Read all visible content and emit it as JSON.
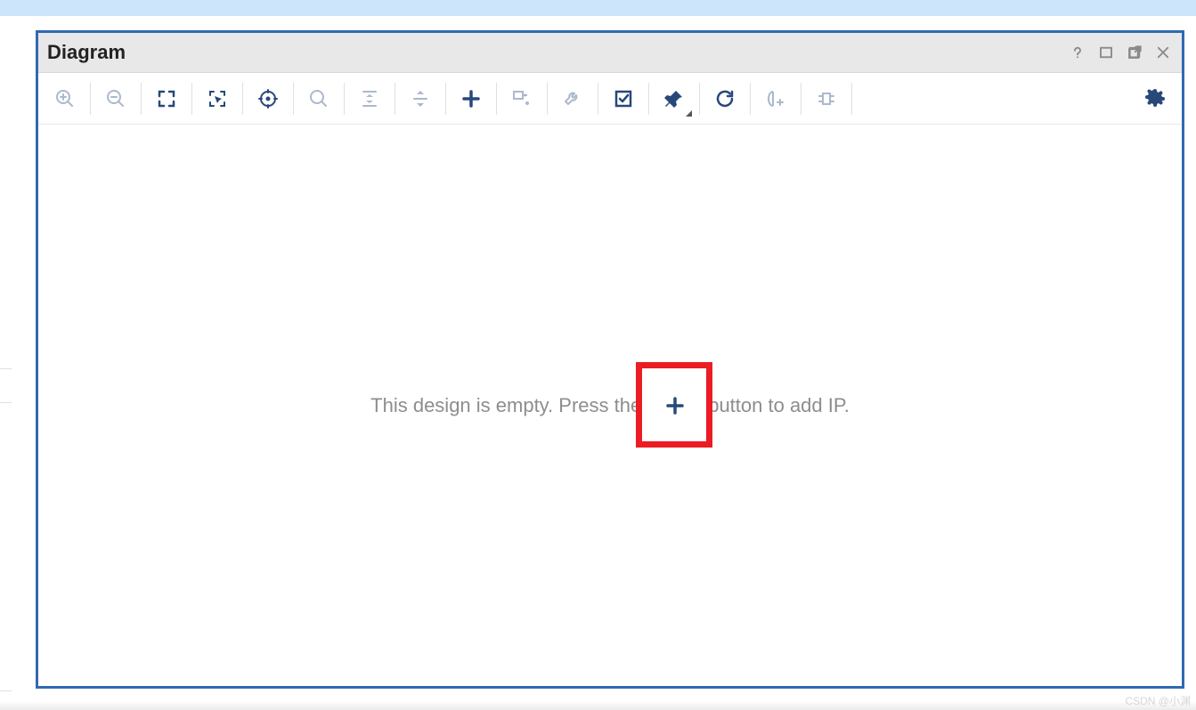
{
  "window": {
    "title": "Diagram",
    "actions": {
      "help_icon": "help",
      "maximize_icon": "maximize",
      "popout_icon": "popout",
      "close_icon": "close"
    }
  },
  "toolbar": {
    "items": [
      {
        "name": "zoom-in",
        "enabled": false
      },
      {
        "name": "zoom-out",
        "enabled": false
      },
      {
        "name": "zoom-fit",
        "enabled": true
      },
      {
        "name": "zoom-area",
        "enabled": true
      },
      {
        "name": "auto-fit",
        "enabled": true
      },
      {
        "name": "search",
        "enabled": false
      },
      {
        "name": "collapse-vert",
        "enabled": false
      },
      {
        "name": "expand-vert",
        "enabled": false
      },
      {
        "name": "add-ip",
        "enabled": true
      },
      {
        "name": "make-connection",
        "enabled": false
      },
      {
        "name": "wrench",
        "enabled": false
      },
      {
        "name": "validate",
        "enabled": true
      },
      {
        "name": "pin",
        "enabled": true,
        "dropdown": true
      },
      {
        "name": "regenerate",
        "enabled": true
      },
      {
        "name": "address-editor",
        "enabled": false
      },
      {
        "name": "default-view",
        "enabled": false
      }
    ],
    "settings_icon": "settings"
  },
  "canvas": {
    "empty_prefix": "This design is empty. Press the",
    "empty_suffix": "button to add IP.",
    "plus_icon": "plus"
  },
  "colors": {
    "accent": "#28487a",
    "highlight": "#eb1c24",
    "border": "#3169b3",
    "disabled": "#b6b6b6"
  },
  "watermark": "CSDN @小渊"
}
